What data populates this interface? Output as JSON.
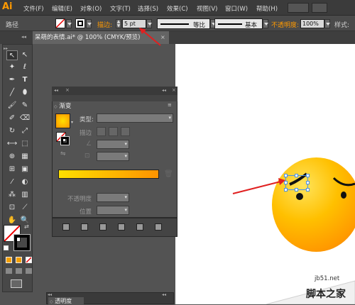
{
  "app": {
    "logo": "Ai"
  },
  "menu": [
    "文件(F)",
    "编辑(E)",
    "对象(O)",
    "文字(T)",
    "选择(S)",
    "效果(C)",
    "视图(V)",
    "窗口(W)",
    "帮助(H)"
  ],
  "control": {
    "selection_label": "路径",
    "stroke_label": "描边:",
    "stroke_value": "5 pt",
    "profile_label": "等比",
    "brush_label": "基本",
    "opacity_label": "不透明度:",
    "opacity_value": "100%",
    "style_label": "样式:"
  },
  "document": {
    "tab_title": "呆萌的表情.ai* @ 100% (CMYK/预览)"
  },
  "gradient_panel": {
    "tab": "渐变",
    "type_label": "类型:",
    "stroke_label": "描边",
    "opacity_label": "不透明度",
    "position_label": "位置",
    "ramp_start_color": "#ffe000",
    "ramp_end_color": "#ff9400"
  },
  "transparency_panel": {
    "tab": "透明度"
  },
  "watermark": {
    "url": "jb51.net",
    "text": "脚本之家"
  },
  "colors": {
    "accent": "#ff9a00",
    "annotation_arrow": "#e02020",
    "face_light": "#ffe45c",
    "face_dark": "#f07e00"
  }
}
